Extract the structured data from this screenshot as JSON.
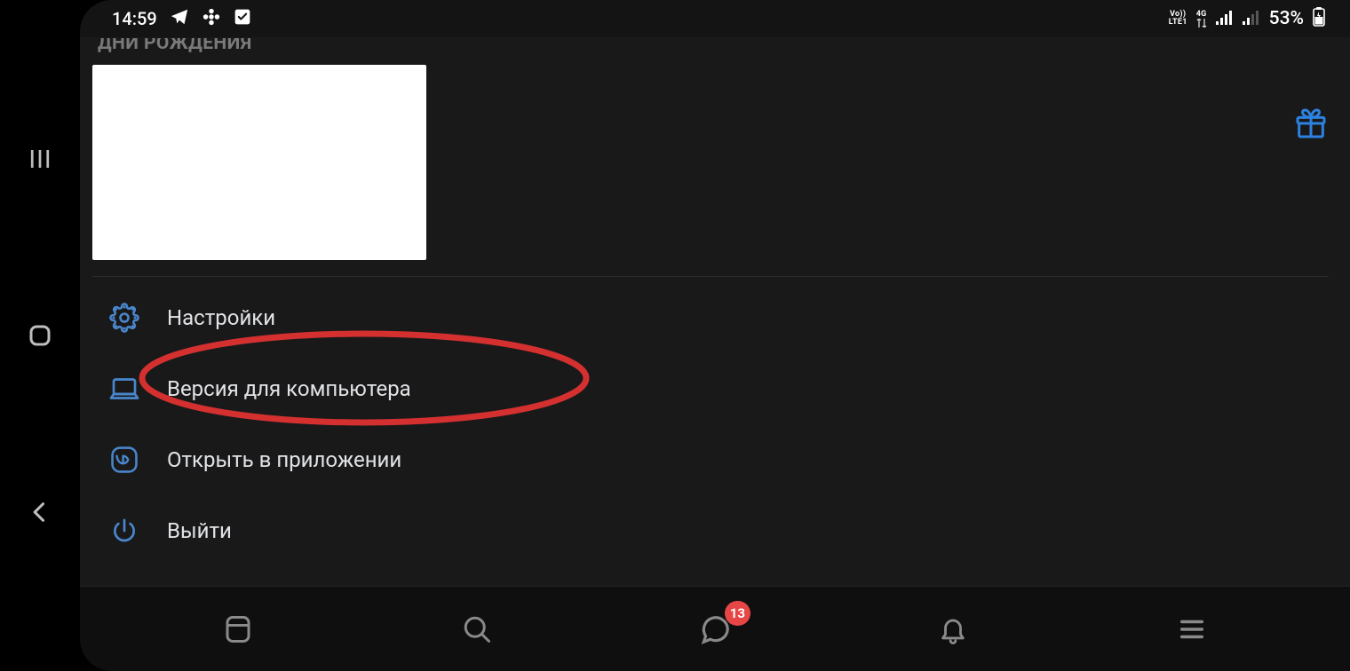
{
  "statusbar": {
    "time": "14:59",
    "net_upper": "Vo))",
    "net_lower": "LTE1",
    "net_gen": "4G",
    "battery_pct": "53%"
  },
  "section_header": "ДНИ РОЖДЕНИЯ",
  "menu": {
    "settings": "Настройки",
    "desktop_version": "Версия для компьютера",
    "open_in_app": "Открыть в приложении",
    "logout": "Выйти"
  },
  "bottom_nav": {
    "messages_badge": "13"
  }
}
